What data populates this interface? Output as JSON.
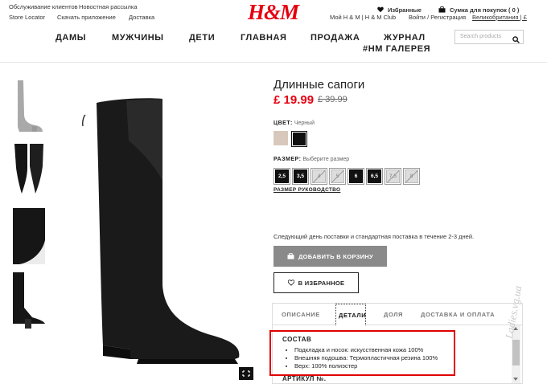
{
  "header": {
    "top_links": {
      "customer_service": "Обслуживание клиентов",
      "newsletter": "Новостная рассылка",
      "store_locator": "Store Locator",
      "download_app": "Скачать приложение",
      "delivery": "Доставка"
    },
    "logo": "H&M",
    "favorites": "Избранные",
    "cart": "Сумка для покупок ( 0 )",
    "account": "Мой H & M | H & M Club",
    "login": "Войти / Регистрация",
    "region": "Великобритания | £"
  },
  "nav": {
    "items": [
      "ДАМЫ",
      "МУЖЧИНЫ",
      "ДЕТИ",
      "ГЛАВНАЯ",
      "ПРОДАЖА",
      "ЖУРНАЛ"
    ],
    "gallery": "#НМ ГАЛЕРЕЯ",
    "search_placeholder": "Search products"
  },
  "product": {
    "title": "Длинные сапоги",
    "price": "£ 19.99",
    "old_price": "£ 39.99",
    "color_label": "ЦВЕТ:",
    "color_value": "Черный",
    "swatches": [
      "#d8c8bc",
      "#111111"
    ],
    "size_label": "РАЗМЕР:",
    "size_hint": "Выберите размер",
    "sizes": [
      {
        "label": "2,5",
        "available": true
      },
      {
        "label": "3,5",
        "available": true
      },
      {
        "label": "4",
        "available": false
      },
      {
        "label": "5",
        "available": false
      },
      {
        "label": "6",
        "available": true
      },
      {
        "label": "6,5",
        "available": true
      },
      {
        "label": "7,5",
        "available": false
      },
      {
        "label": "8",
        "available": false
      }
    ],
    "size_guide": "РАЗМЕР РУКОВОДСТВО",
    "delivery_text": "Следующий день поставки и стандартная поставка в течение 2-3 дней.",
    "add_to_bag": "ДОБАВИТЬ В КОРЗИНУ",
    "add_to_favorites": "В ИЗБРАННОЕ"
  },
  "tabs": [
    "ОПИСАНИЕ",
    "ДЕТАЛИ",
    "ДОЛЯ",
    "ДОСТАВКА И ОПЛАТА"
  ],
  "details": {
    "heading": "СОСТАВ",
    "items": [
      "Подкладка и носок: искусственная кожа 100%",
      "Внешняя подошва: Термопластичная резина 100%",
      "Верх: 100% полиэстер"
    ],
    "article_label": "АРТИКУЛ №."
  },
  "watermark": "Ladies.vg.ua",
  "colors": {
    "brand_red": "#e50010",
    "highlight_red": "#e00000",
    "button_gray": "#8a8a8a"
  }
}
